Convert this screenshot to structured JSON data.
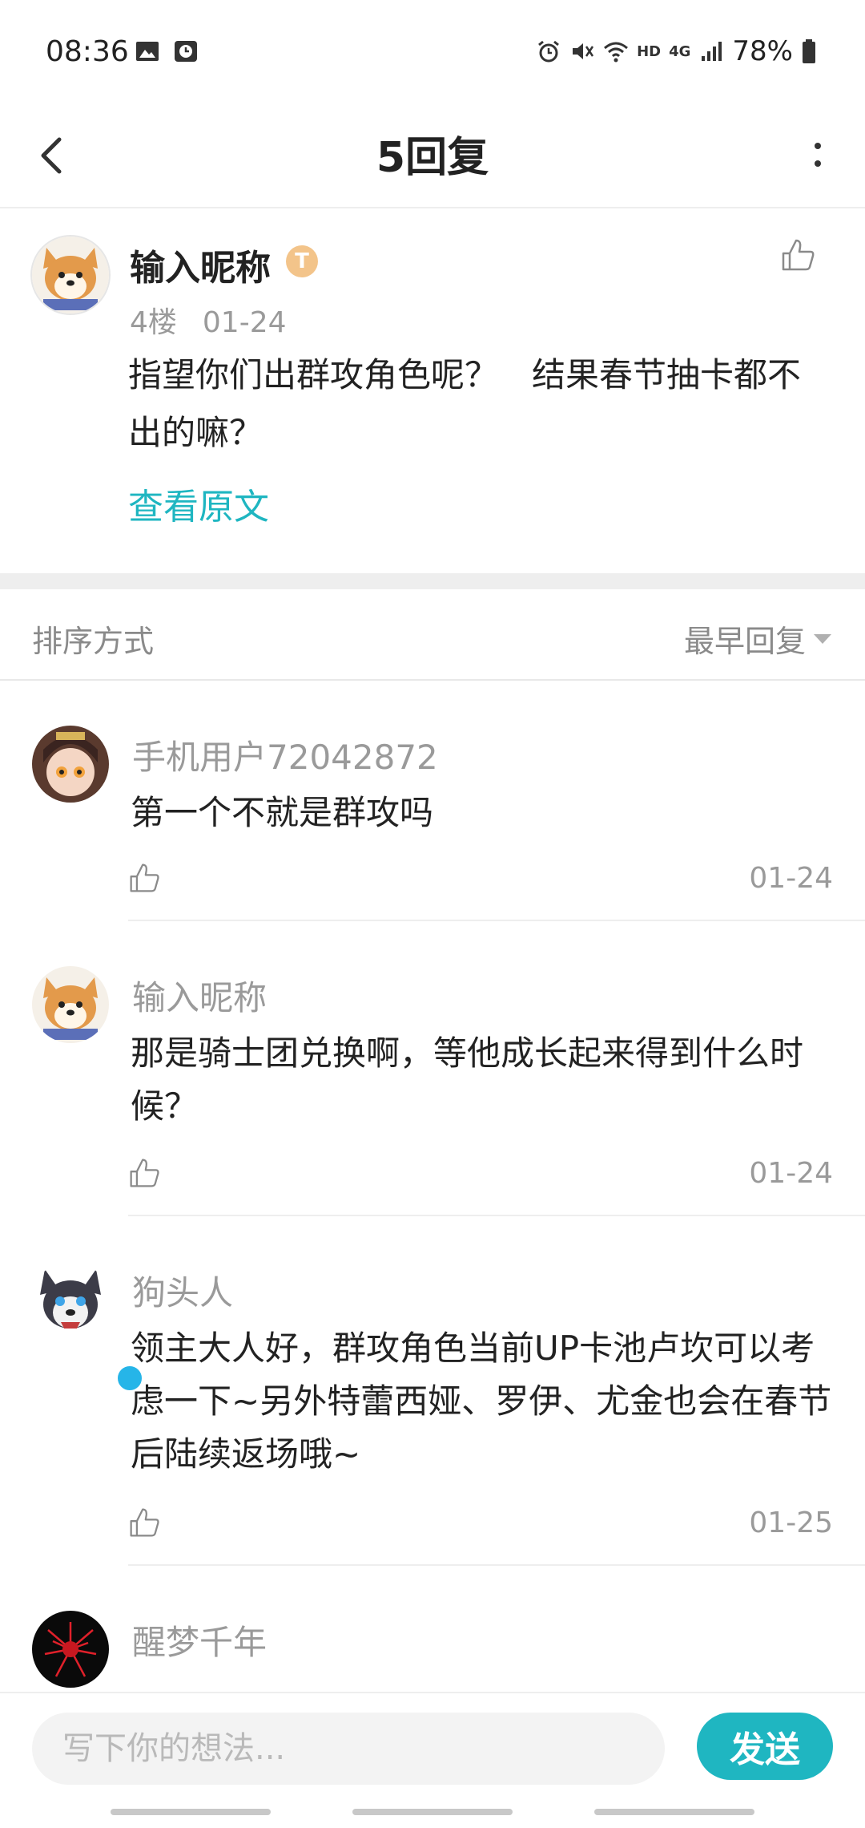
{
  "status_bar": {
    "time": "08:36",
    "battery": "78%",
    "left_icons": [
      "gallery-icon",
      "clock-app-icon"
    ],
    "right_icons": [
      "alarm-icon",
      "mute-icon",
      "wifi-icon",
      "hd-icon",
      "signal-icon",
      "battery-icon"
    ],
    "hd_text": "HD",
    "network_text": "4G"
  },
  "nav": {
    "title": "5回复",
    "back_icon": "chevron-left-icon",
    "more_icon": "more-vertical-icon"
  },
  "original_post": {
    "author": "输入昵称",
    "badge": "T",
    "floor": "4楼",
    "date": "01-24",
    "text": "指望你们出群攻角色呢？　结果春节抽卡都不出的嘛？",
    "view_original": "查看原文"
  },
  "sort": {
    "label": "排序方式",
    "selected": "最早回复"
  },
  "replies": [
    {
      "author": "手机用户72042872",
      "text": "第一个不就是群攻吗",
      "date": "01-24"
    },
    {
      "author": "输入昵称",
      "text": "那是骑士团兑换啊，等他成长起来得到什么时候？",
      "date": "01-24"
    },
    {
      "author": "狗头人",
      "text": "领主大人好，群攻角色当前UP卡池卢坎可以考虑一下~另外特蕾西娅、罗伊、尤金也会在春节后陆续返场哦~",
      "date": "01-25"
    },
    {
      "author": "醒梦千年",
      "text": "",
      "date": ""
    }
  ],
  "input": {
    "placeholder": "写下你的想法...",
    "send_label": "发送"
  },
  "colors": {
    "accent": "#1fb6c1",
    "muted_text": "#9a9a9a",
    "divider": "#eeeeee"
  }
}
